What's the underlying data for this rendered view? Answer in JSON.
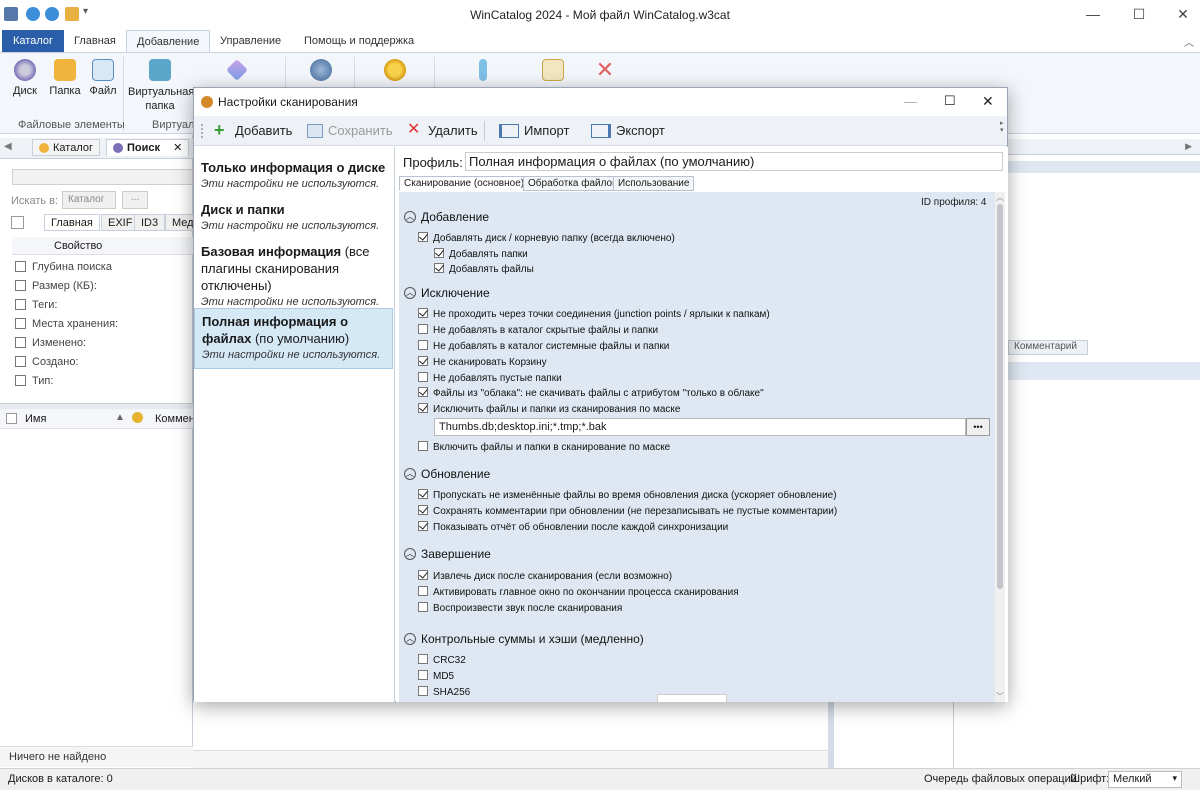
{
  "window": {
    "title": "WinCatalog 2024 - Мой файл WinCatalog.w3cat"
  },
  "ribbon": {
    "tabs": [
      "Каталог",
      "Главная",
      "Добавление",
      "Управление",
      "Помощь и поддержка"
    ],
    "buttons": [
      "Диск",
      "Папка",
      "Файл",
      "Виртуальная папка",
      "Виртуал"
    ],
    "groups": [
      "Файловые элементы"
    ]
  },
  "left": {
    "tabs": [
      "Каталог",
      "Поиск"
    ],
    "search_in_label": "Искать в:",
    "search_in_value": "Каталог",
    "search_in_more": "...",
    "prop_tabs": [
      "Главная",
      "EXIF",
      "ID3",
      "Мед"
    ],
    "prop_header": "Свойство",
    "props": [
      "Глубина поиска",
      "Размер (КБ):",
      "Теги:",
      "Места хранения:",
      "Изменено:",
      "Создано:",
      "Тип:"
    ],
    "list_cols": [
      "Имя",
      "Коммен"
    ],
    "status": "Ничего не найдено"
  },
  "right": {
    "tab": "Комментарий"
  },
  "statusbar": {
    "disks": "Дисков в каталоге: 0",
    "queue": "Очередь файловых операций",
    "font_label": "Шрифт:",
    "font_value": "Мелкий"
  },
  "dialog": {
    "title": "Настройки сканирования",
    "toolbar": {
      "add": "Добавить",
      "save": "Сохранить",
      "delete": "Удалить",
      "import": "Импорт",
      "export": "Экспорт"
    },
    "profiles": [
      {
        "name": "Только информация о диске",
        "extra": "",
        "note": "Эти настройки не используются."
      },
      {
        "name": "Диск и папки",
        "extra": "",
        "note": "Эти настройки не используются."
      },
      {
        "name": "Базовая информация",
        "extra": "(все плагины сканирования отключены)",
        "note": "Эти настройки не используются."
      },
      {
        "name": "Полная информация о файлах",
        "extra": "(по умолчанию)",
        "note": "Эти настройки не используются."
      }
    ],
    "profile_label": "Профиль:",
    "profile_value": "Полная информация о файлах (по умолчанию)",
    "sub_tabs": [
      "Сканирование (основное)",
      "Обработка файлов",
      "Использование"
    ],
    "profile_id": "ID профиля: 4",
    "sections": {
      "add": "Добавление",
      "add_opts": [
        "Добавлять диск / корневую папку (всегда включено)",
        "Добавлять папки",
        "Добавлять файлы"
      ],
      "exclude": "Исключение",
      "exclude_opts": [
        "Не проходить через точки соединения (junction points / ярлыки к папкам)",
        "Не добавлять в каталог скрытые файлы и папки",
        "Не добавлять в каталог системные файлы и папки",
        "Не сканировать Корзину",
        "Не добавлять пустые папки",
        "Файлы из \"облака\": не скачивать файлы с атрибутом \"только в облаке\"",
        "Исключить файлы и папки из сканирования по маске"
      ],
      "mask": "Thumbs.db;desktop.ini;*.tmp;*.bak",
      "mask_btn": "•••",
      "include_mask": "Включить файлы и папки в сканирование по маске",
      "update": "Обновление",
      "update_opts": [
        "Пропускать не изменённые файлы во время обновления диска (ускоряет обновление)",
        "Сохранять комментарии при обновлении (не перезаписывать не пустые комментарии)",
        "Показывать отчёт об обновлении после каждой синхронизации"
      ],
      "finish": "Завершение",
      "finish_opts": [
        "Извлечь диск после сканирования (если возможно)",
        "Активировать главное окно по окончании процесса сканирования",
        "Воспроизвести звук после сканирования"
      ],
      "hash": "Контрольные суммы и хэши (медленно)",
      "hash_opts": [
        "CRC32",
        "MD5",
        "SHA256"
      ]
    },
    "checked": {
      "add": [
        true,
        true,
        true
      ],
      "exclude": [
        true,
        false,
        false,
        true,
        false,
        true,
        true
      ],
      "include_mask": false,
      "update": [
        true,
        true,
        true
      ],
      "finish": [
        true,
        false,
        false
      ],
      "hash": [
        false,
        false,
        false
      ]
    }
  }
}
